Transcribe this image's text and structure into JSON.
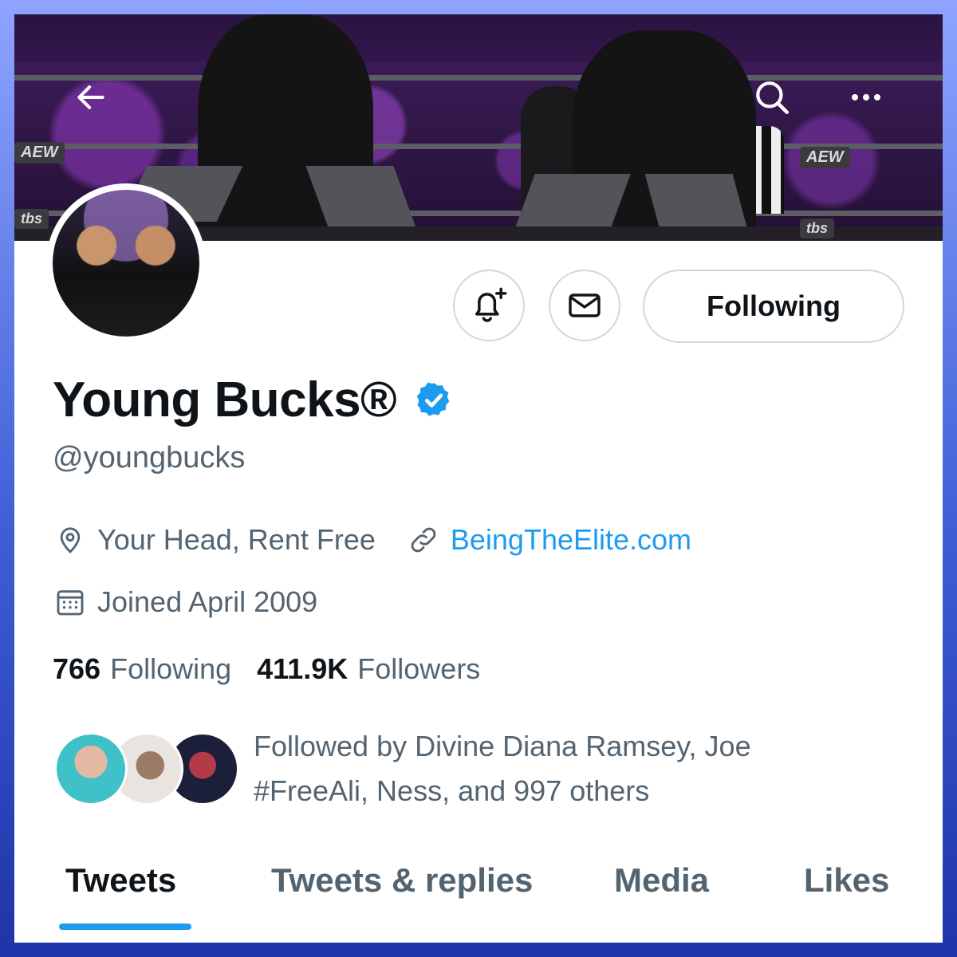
{
  "nav": {
    "back_icon": "arrow-left-icon",
    "search_icon": "search-icon",
    "more_icon": "more-horizontal-icon"
  },
  "banner": {
    "logos": [
      "AEW",
      "AEW",
      "tbs",
      "tbs"
    ]
  },
  "actions": {
    "notify_icon": "bell-plus-icon",
    "message_icon": "envelope-icon",
    "following_label": "Following"
  },
  "profile": {
    "display_name": "Young Bucks®",
    "verified_icon": "verified-badge-icon",
    "handle": "@youngbucks",
    "location": "Your Head, Rent Free",
    "website": "BeingTheElite.com",
    "joined": "Joined April 2009"
  },
  "stats": {
    "following_count": "766",
    "following_label": "Following",
    "followers_count": "411.9K",
    "followers_label": "Followers"
  },
  "followed_by": {
    "text": "Followed by Divine Diana Ramsey, Joe #FreeAli, Ness, and 997 others"
  },
  "tabs": [
    {
      "label": "Tweets",
      "active": true
    },
    {
      "label": "Tweets & replies",
      "active": false
    },
    {
      "label": "Media",
      "active": false
    },
    {
      "label": "Likes",
      "active": false
    }
  ],
  "colors": {
    "accent": "#1d9bf0",
    "text_primary": "#0f1419",
    "text_secondary": "#536471",
    "frame": "#3f5fd6"
  }
}
